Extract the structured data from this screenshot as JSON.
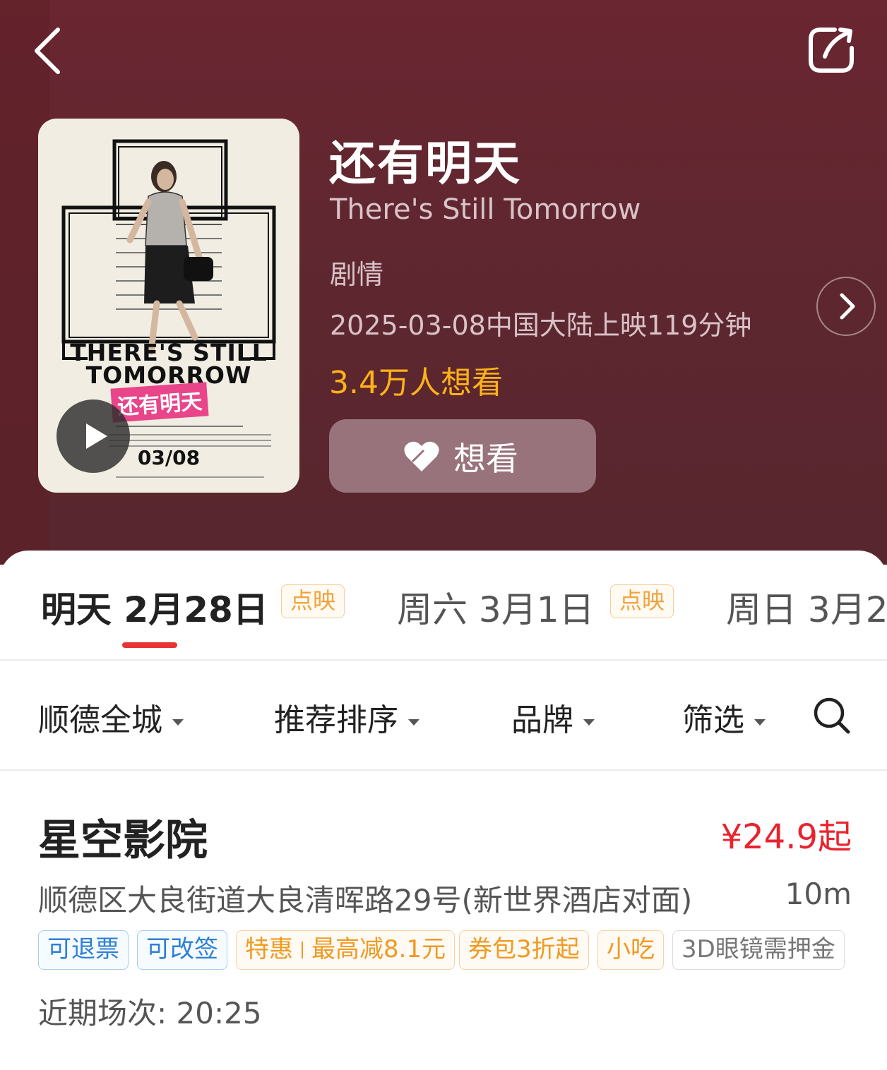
{
  "movie": {
    "title_cn": "还有明天",
    "title_en": "There's Still Tomorrow",
    "genre": "剧情",
    "release_info": "2025-03-08中国大陆上映119分钟",
    "want_count": "3.4万人想看",
    "want_button_label": "想看",
    "poster": {
      "title_line1": "THERE'S STILL",
      "title_line2": "TOMORROW",
      "title_cn": "还有明天",
      "date": "03/08"
    }
  },
  "date_tabs": [
    {
      "label": "明天 2月28日",
      "badge": "点映",
      "active": true
    },
    {
      "label": "周六 3月1日",
      "badge": "点映",
      "active": false
    },
    {
      "label": "周日 3月2",
      "badge": "",
      "active": false
    }
  ],
  "filters": [
    {
      "label": "顺德全城"
    },
    {
      "label": "推荐排序"
    },
    {
      "label": "品牌"
    },
    {
      "label": "筛选"
    }
  ],
  "cinema": {
    "name": "星空影院",
    "price": "¥24.9起",
    "address": "顺德区大良街道大良清晖路29号(新世界酒店对面)",
    "distance": "10m",
    "tags": [
      {
        "text": "可退票",
        "style": "blue"
      },
      {
        "text": "可改签",
        "style": "blue"
      },
      {
        "text_a": "特惠",
        "text_b": "最高减8.1元",
        "style": "orange"
      },
      {
        "text": "券包3折起",
        "style": "orange"
      },
      {
        "text": "小吃",
        "style": "orange"
      },
      {
        "text": "3D眼镜需押金",
        "style": "gray"
      }
    ],
    "showtimes": "近期场次: 20:25"
  },
  "icons": {
    "back": "back-arrow-icon",
    "share": "share-icon",
    "play": "play-icon",
    "detail": "chevron-right-icon",
    "want": "heart-icon",
    "search": "search-icon"
  },
  "colors": {
    "hero_bg": "#5f2730",
    "want_count": "#ffb219",
    "price": "#e9232e",
    "tab_indicator": "#e83434"
  }
}
